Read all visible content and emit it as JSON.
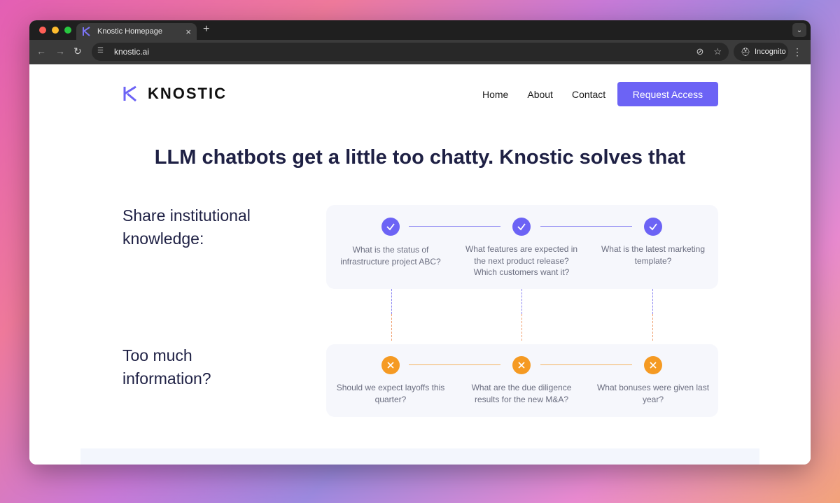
{
  "browser": {
    "tab_title": "Knostic Homepage",
    "tab_close": "×",
    "new_tab": "+",
    "url": "knostic.ai",
    "incognito_label": "Incognito"
  },
  "site": {
    "logo_text": "KNOSTIC",
    "nav": [
      "Home",
      "About",
      "Contact"
    ],
    "cta_label": "Request Access",
    "headline": "LLM chatbots get a little too chatty. Knostic solves that",
    "sections": [
      {
        "label": "Share institutional knowledge:",
        "status": "allowed",
        "questions": [
          "What is the status of infrastructure project ABC?",
          "What features are expected in the next product release? Which customers want it?",
          "What is the latest marketing template?"
        ]
      },
      {
        "label": "Too much information?",
        "status": "blocked",
        "questions": [
          "Should we expect layoffs this quarter?",
          "What are the due diligence results for the new M&A?",
          "What bonuses were given last year?"
        ]
      }
    ]
  },
  "colors": {
    "accent": "#6c63f5",
    "warning": "#f59a23",
    "headline": "#1e2044"
  },
  "icons": {
    "check": "check-icon",
    "cross": "x-icon"
  }
}
